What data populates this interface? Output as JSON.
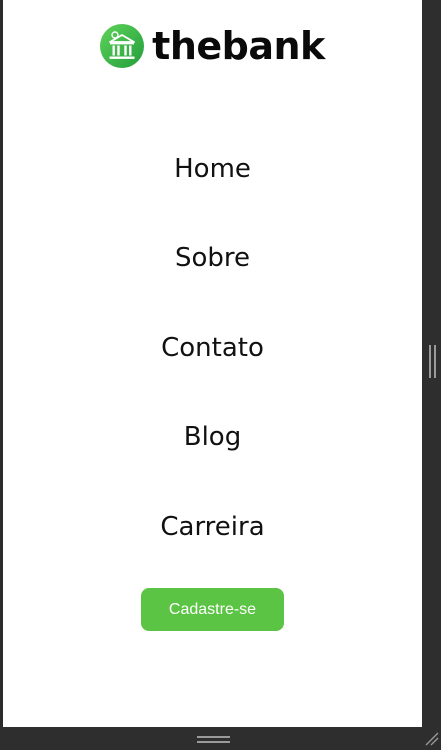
{
  "brand": {
    "name": "thebank",
    "logo_icon": "bank-building-icon",
    "logo_color": "#3fb64a"
  },
  "nav": {
    "items": [
      {
        "label": "Home"
      },
      {
        "label": "Sobre"
      },
      {
        "label": "Contato"
      },
      {
        "label": "Blog"
      },
      {
        "label": "Carreira"
      }
    ]
  },
  "cta": {
    "label": "Cadastre-se",
    "color": "#5bc444"
  },
  "chrome": {
    "background": "#2e2e2e",
    "right_handle_icon": "vertical-resize-handle-icon",
    "bottom_handle_icon": "horizontal-resize-handle-icon",
    "corner_icon": "resize-corner-icon"
  }
}
